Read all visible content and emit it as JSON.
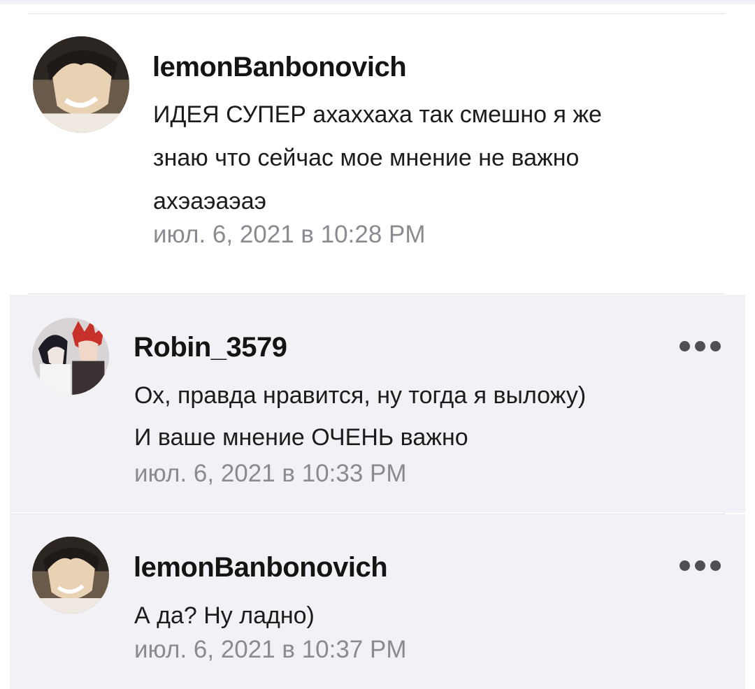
{
  "comments": [
    {
      "author": "lemonBanbonovich",
      "text_lines": [
        "ИДЕЯ СУПЕР ахаххаха так смешно я же",
        "знаю что сейчас мое мнение не важно",
        "ахэаэаэаэ"
      ],
      "timestamp": "июл. 6, 2021 в 10:28 PM",
      "avatar_icon": "anime-avatar-icon"
    },
    {
      "author": "Robin_3579",
      "text_lines": [
        "Ох, правда нравится, ну тогда я выложу)",
        "И ваше мнение ОЧЕНЬ важно"
      ],
      "timestamp": "июл. 6, 2021 в 10:33 PM",
      "avatar_icon": "anime-avatar-icon",
      "menu_icon": "more-dots-icon"
    },
    {
      "author": "lemonBanbonovich",
      "text_lines": [
        "А да? Ну ладно)"
      ],
      "timestamp": "июл. 6, 2021 в 10:37 PM",
      "avatar_icon": "anime-avatar-icon",
      "menu_icon": "more-dots-icon"
    }
  ],
  "colors": {
    "reply_background": "#f2f1f6",
    "author_text": "#141414",
    "timestamp_text": "#8a8a90",
    "divider": "#e1e1e6"
  }
}
